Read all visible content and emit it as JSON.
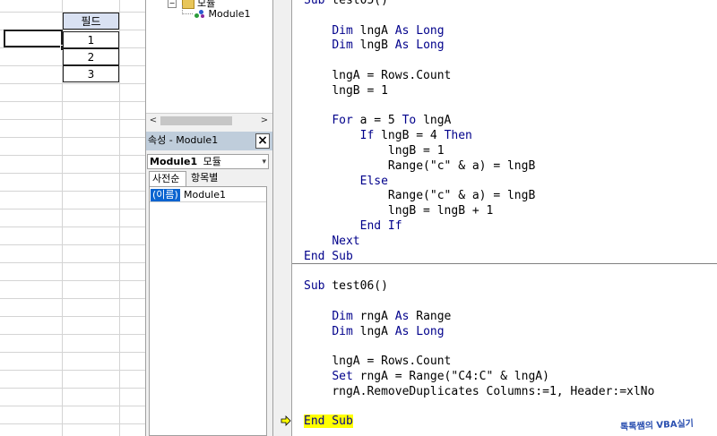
{
  "sheet": {
    "header": "필드",
    "values": [
      "1",
      "2",
      "3"
    ]
  },
  "project_tree": {
    "folder_label": "모듈",
    "module_label": "Module1"
  },
  "properties": {
    "title": "속성 - Module1",
    "object_name": "Module1",
    "object_type": "모듈",
    "tab_alpha": "사전순",
    "tab_category": "항목별",
    "prop_name": "(이름)",
    "prop_value": "Module1"
  },
  "code": {
    "lines": [
      {
        "indent": "",
        "parts": [
          [
            "kw",
            "Sub"
          ],
          [
            "t",
            " test05()"
          ]
        ]
      },
      {
        "indent": "",
        "parts": []
      },
      {
        "indent": "    ",
        "parts": [
          [
            "kw",
            "Dim"
          ],
          [
            "t",
            " lngA "
          ],
          [
            "kw",
            "As Long"
          ]
        ]
      },
      {
        "indent": "    ",
        "parts": [
          [
            "kw",
            "Dim"
          ],
          [
            "t",
            " lngB "
          ],
          [
            "kw",
            "As Long"
          ]
        ]
      },
      {
        "indent": "",
        "parts": []
      },
      {
        "indent": "    ",
        "parts": [
          [
            "t",
            "lngA = Rows.Count"
          ]
        ]
      },
      {
        "indent": "    ",
        "parts": [
          [
            "t",
            "lngB = 1"
          ]
        ]
      },
      {
        "indent": "",
        "parts": []
      },
      {
        "indent": "    ",
        "parts": [
          [
            "kw",
            "For"
          ],
          [
            "t",
            " a = 5 "
          ],
          [
            "kw",
            "To"
          ],
          [
            "t",
            " lngA"
          ]
        ]
      },
      {
        "indent": "        ",
        "parts": [
          [
            "kw",
            "If"
          ],
          [
            "t",
            " lngB = 4 "
          ],
          [
            "kw",
            "Then"
          ]
        ]
      },
      {
        "indent": "            ",
        "parts": [
          [
            "t",
            "lngB = 1"
          ]
        ]
      },
      {
        "indent": "            ",
        "parts": [
          [
            "t",
            "Range(\"c\" & a) = lngB"
          ]
        ]
      },
      {
        "indent": "        ",
        "parts": [
          [
            "kw",
            "Else"
          ]
        ]
      },
      {
        "indent": "            ",
        "parts": [
          [
            "t",
            "Range(\"c\" & a) = lngB"
          ]
        ]
      },
      {
        "indent": "            ",
        "parts": [
          [
            "t",
            "lngB = lngB + 1"
          ]
        ]
      },
      {
        "indent": "        ",
        "parts": [
          [
            "kw",
            "End If"
          ]
        ]
      },
      {
        "indent": "    ",
        "parts": [
          [
            "kw",
            "Next"
          ]
        ]
      },
      {
        "indent": "",
        "parts": [
          [
            "kw",
            "End Sub"
          ]
        ]
      },
      {
        "indent": "",
        "parts": []
      },
      {
        "indent": "",
        "parts": [
          [
            "kw",
            "Sub"
          ],
          [
            "t",
            " test06()"
          ]
        ]
      },
      {
        "indent": "",
        "parts": []
      },
      {
        "indent": "    ",
        "parts": [
          [
            "kw",
            "Dim"
          ],
          [
            "t",
            " rngA "
          ],
          [
            "kw",
            "As"
          ],
          [
            "t",
            " Range"
          ]
        ]
      },
      {
        "indent": "    ",
        "parts": [
          [
            "kw",
            "Dim"
          ],
          [
            "t",
            " lngA "
          ],
          [
            "kw",
            "As Long"
          ]
        ]
      },
      {
        "indent": "",
        "parts": []
      },
      {
        "indent": "    ",
        "parts": [
          [
            "t",
            "lngA = Rows.Count"
          ]
        ]
      },
      {
        "indent": "    ",
        "parts": [
          [
            "kw",
            "Set"
          ],
          [
            "t",
            " rngA = Range(\"C4:C\" & lngA)"
          ]
        ]
      },
      {
        "indent": "    ",
        "parts": [
          [
            "t",
            "rngA.RemoveDuplicates Columns:=1, Header:=xlNo"
          ]
        ]
      },
      {
        "indent": "",
        "parts": []
      },
      {
        "indent": "",
        "parts": [
          [
            "exec",
            "End Sub"
          ]
        ]
      }
    ]
  },
  "watermark": "톡톡쌤의 VBA실기",
  "colors": {
    "keyword": "#00008b",
    "execution_highlight": "#ffff00",
    "header_fill": "#d9e1f2"
  }
}
